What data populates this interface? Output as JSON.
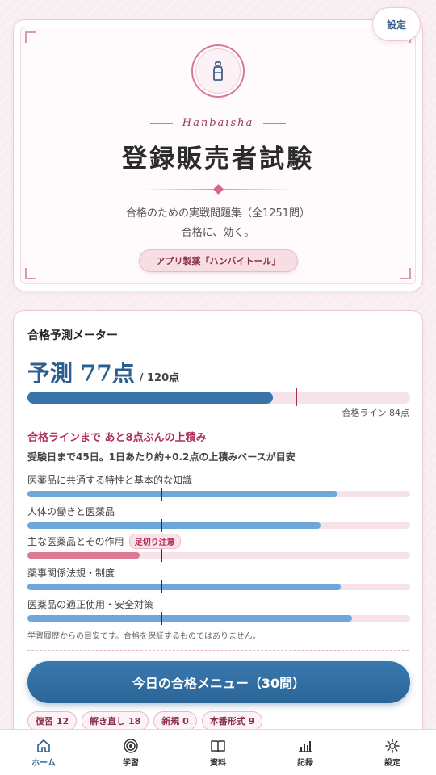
{
  "hero": {
    "settings_label": "設定",
    "subtitle": "Hanbaisha",
    "title": "登録販売者試験",
    "desc_line1": "合格のための実戦問題集（全1251問）",
    "desc_line2": "合格に、効く。",
    "maker": "アプリ製薬「ハンバイトール」",
    "icon": "medicine-bottle-icon"
  },
  "meter": {
    "title": "合格予測メーター",
    "prediction_label": "予測 77点",
    "total_label": "/ 120点",
    "score": 77,
    "max_score": 120,
    "pass_line_score": 84,
    "pass_line_label": "合格ライン 84点",
    "gap_message": "合格ラインまで あと8点ぶんの上積み",
    "pace_message": "受験日まで45日。1日あたり約+0.2点の上積みペースが目安",
    "subjects": [
      {
        "label": "医薬品に共通する特性と基本的な知識",
        "progress": 0.81,
        "warning": "",
        "threshold": 0.35
      },
      {
        "label": "人体の働きと医薬品",
        "progress": 0.766,
        "warning": "",
        "threshold": 0.35
      },
      {
        "label": "主な医薬品とその作用",
        "progress": 0.293,
        "warning": "足切り注意",
        "threshold": 0.35
      },
      {
        "label": "薬事関係法規・制度",
        "progress": 0.818,
        "warning": "",
        "threshold": 0.35
      },
      {
        "label": "医薬品の適正使用・安全対策",
        "progress": 0.848,
        "warning": "",
        "threshold": 0.35
      }
    ],
    "disclaimer": "学習履歴からの目安です。合格を保証するものではありません。",
    "cta_label": "今日の合格メニュー（30問）",
    "chips": [
      "復習 12",
      "解き直し 18",
      "新規 0",
      "本番形式 9"
    ]
  },
  "colors": {
    "accent_blue": "#3674aa",
    "accent_pink": "#b02f55",
    "warning_bar": "#dc7a93"
  },
  "tabs": [
    {
      "label": "ホーム",
      "icon": "home-icon",
      "active": true
    },
    {
      "label": "学習",
      "icon": "target-icon",
      "active": false
    },
    {
      "label": "資料",
      "icon": "book-icon",
      "active": false
    },
    {
      "label": "記録",
      "icon": "bar-chart-icon",
      "active": false
    },
    {
      "label": "設定",
      "icon": "gear-icon",
      "active": false
    }
  ]
}
